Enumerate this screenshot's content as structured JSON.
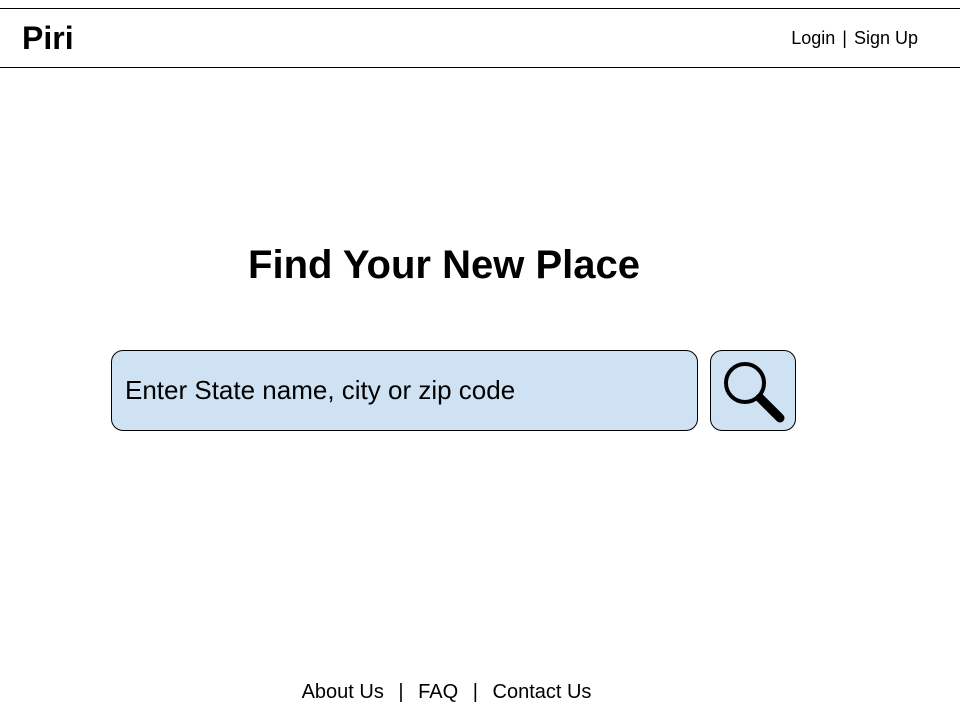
{
  "header": {
    "logo": "Piri",
    "login_label": "Login",
    "separator": "|",
    "signup_label": "Sign Up"
  },
  "hero": {
    "title": "Find Your New Place"
  },
  "search": {
    "placeholder": "Enter State name, city or zip code",
    "value": "",
    "button_icon": "search-icon"
  },
  "footer": {
    "about_label": "About Us",
    "faq_label": "FAQ",
    "contact_label": "Contact Us",
    "separator": "|"
  },
  "colors": {
    "search_fill": "#cfe2f3",
    "border": "#000000",
    "text": "#000000",
    "background": "#ffffff"
  }
}
